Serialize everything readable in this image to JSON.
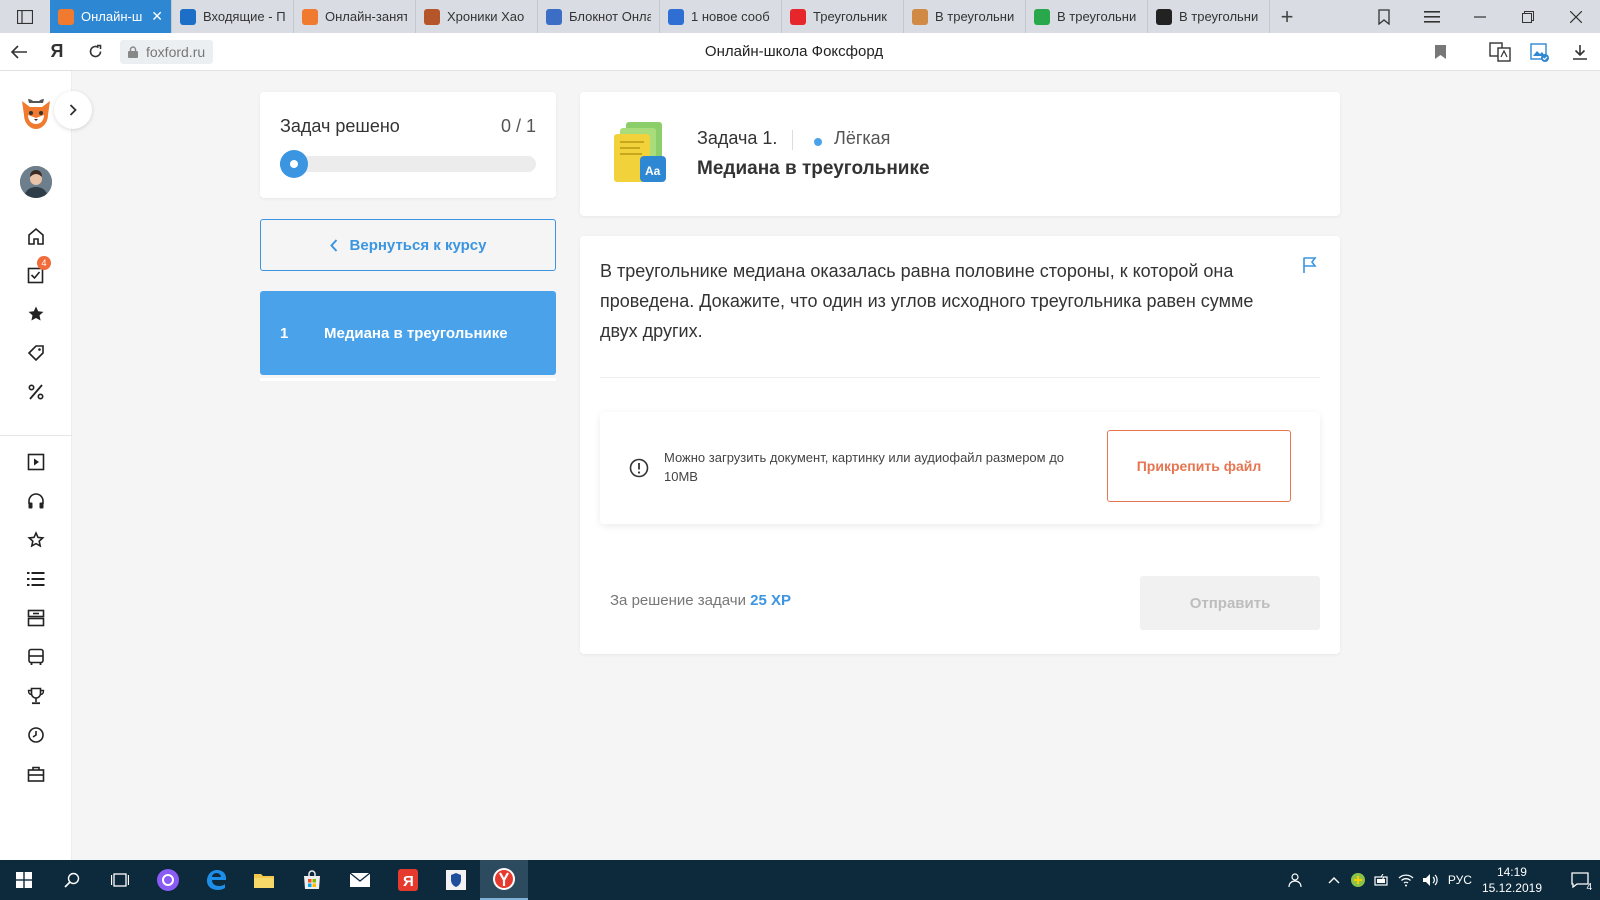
{
  "browser": {
    "tabs": [
      {
        "label": "Онлайн-ш",
        "active": true,
        "favicon": "fox-icon",
        "color": "#f07a2f"
      },
      {
        "label": "Входящие - П",
        "active": false,
        "favicon": "mail-icon",
        "color": "#1c6ec6"
      },
      {
        "label": "Онлайн-занят",
        "active": false,
        "favicon": "fox-icon",
        "color": "#f07a2f"
      },
      {
        "label": "Хроники Хао",
        "active": false,
        "favicon": "game-icon",
        "color": "#b4562a"
      },
      {
        "label": "Блокнот Онла",
        "active": false,
        "favicon": "notepad-icon",
        "color": "#3b6ec4"
      },
      {
        "label": "1 новое сооб",
        "active": false,
        "favicon": "message-icon",
        "color": "#2f6fd3"
      },
      {
        "label": "Треугольник",
        "active": false,
        "favicon": "yandex-icon",
        "color": "#e7262b"
      },
      {
        "label": "В треугольни",
        "active": false,
        "favicon": "face-icon",
        "color": "#d08a43"
      },
      {
        "label": "В треугольни",
        "active": false,
        "favicon": "chat-icon",
        "color": "#29a84b"
      },
      {
        "label": "В треугольни",
        "active": false,
        "favicon": "z-icon",
        "color": "#222222"
      }
    ],
    "address": "foxford.ru",
    "page_title": "Онлайн-школа Фоксфорд",
    "yandex_letter": "Я"
  },
  "sidebar": {
    "badge_count": "4"
  },
  "progress": {
    "label": "Задач решено",
    "count": "0 / 1",
    "value_fraction": 0.0
  },
  "back_button": {
    "label": "Вернуться к курсу"
  },
  "task_list": [
    {
      "number": "1",
      "title": "Медиана в треугольнике"
    }
  ],
  "task": {
    "number_label": "Задача 1.",
    "difficulty": "Лёгкая",
    "title": "Медиана в треугольнике",
    "text": "В треугольнике медиана оказалась равна половине стороны, к которой она проведена. Докажите, что один из углов исходного треугольника равен сумме двух других.",
    "upload_hint": "Можно загрузить документ, картинку или аудиофайл размером до 10MB",
    "attach_label": "Прикрепить файл",
    "reward_prefix": "За решение задачи",
    "reward_xp": "25 XP",
    "submit_label": "Отправить"
  },
  "taskbar": {
    "lang": "РУС",
    "time": "14:19",
    "date": "15.12.2019",
    "notifications": "4"
  },
  "colors": {
    "accent_blue": "#3b95e0",
    "task_item_blue": "#4aa3ea",
    "attach_orange": "#e57651",
    "active_tab": "#2d87d3",
    "taskbar_bg": "#0c2a3c"
  }
}
